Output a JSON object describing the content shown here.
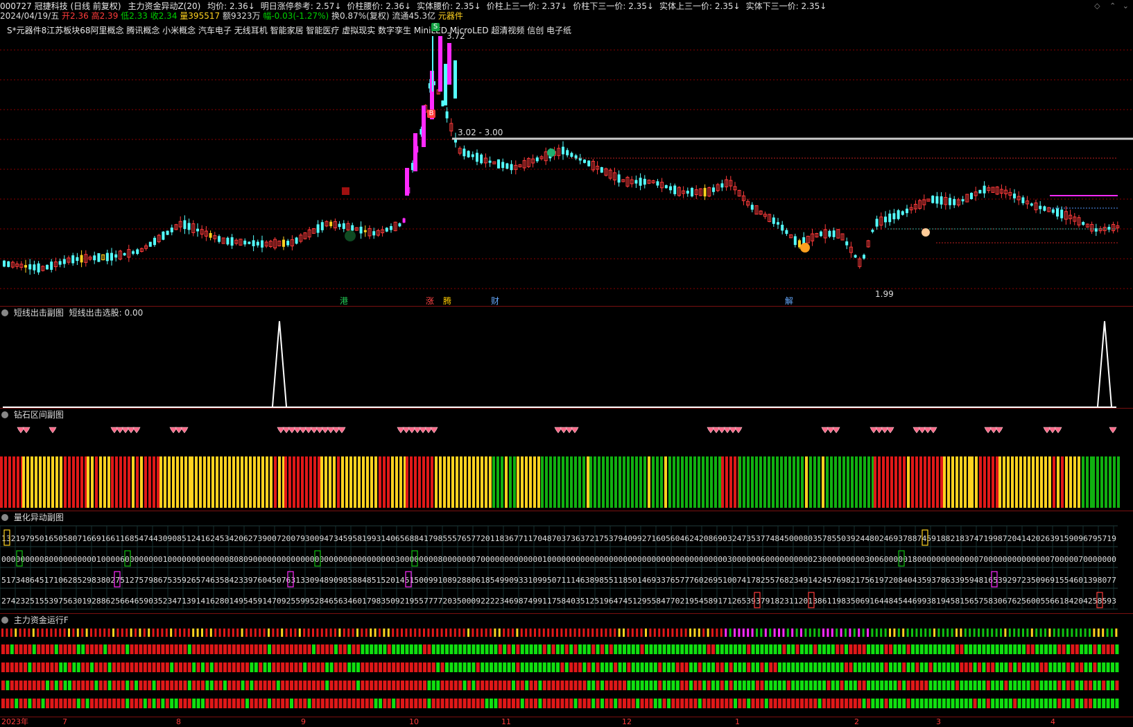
{
  "header": {
    "stock": "000727 冠捷科技 (日线 前复权)",
    "indicator": "主力资金异动Z(20)",
    "items": [
      {
        "label": "均价: 2.36↓",
        "color": "#e0e0e0"
      },
      {
        "label": "明日涨停参考: 2.57↓",
        "color": "#e0e0e0"
      },
      {
        "label": "价柱腰价: 2.36↓",
        "color": "#e0e0e0"
      },
      {
        "label": "实体腰价: 2.35↓",
        "color": "#e0e0e0"
      },
      {
        "label": "价柱上三一价: 2.37↓",
        "color": "#e0e0e0"
      },
      {
        "label": "价柱下三一价: 2.35↓",
        "color": "#e0e0e0"
      },
      {
        "label": "实体上三一价: 2.35↓",
        "color": "#e0e0e0"
      },
      {
        "label": "实体下三一价: 2.35↓",
        "color": "#e0e0e0"
      }
    ]
  },
  "quote": {
    "date": "2024/04/19/五",
    "open": "开2.36",
    "high": "高2.39",
    "low": "低2.33",
    "close": "收2.34",
    "volume": "量395517",
    "amount": "额9323万",
    "change": "幅-0.03(-1.27%)",
    "turnover": "换0.87%(复权)",
    "float": "流通45.3亿",
    "sector": "元器件"
  },
  "concepts": "S*元器件8江苏板块68阿里概念 腾讯概念 小米概念 汽车电子 无线耳机 智能家居 智能医疗 虚拟现实 数字孪生 MiniLED MicroLED 超清视频 信创 电子纸",
  "main_chart": {
    "high_label": "3.72",
    "range_label": "3.02 - 3.00",
    "low_label": "1.99",
    "signals": [
      {
        "label": "港",
        "color": "#22cc55"
      },
      {
        "label": "涨",
        "color": "#ff4444"
      },
      {
        "label": "腾",
        "color": "#ffcc00"
      },
      {
        "label": "财",
        "color": "#66aaff"
      },
      {
        "label": "解",
        "color": "#66aaff"
      }
    ],
    "markers": {
      "buy": "B",
      "sell": "S"
    }
  },
  "panels": {
    "p1_title": "短线出击副图",
    "p1_value": "短线出击选股: 0.00",
    "p2_title": "钻石区间副图",
    "p3_title": "量化异动副图",
    "p4_title": "主力资金运行F"
  },
  "xaxis": {
    "labels": [
      "2023年",
      "7",
      "8",
      "9",
      "10",
      "11",
      "12",
      "1",
      "2",
      "3",
      "4"
    ]
  },
  "colors": {
    "up": "#ff3b3b",
    "down": "#54ffff",
    "yellow": "#ffd21f",
    "green": "#00c000",
    "magenta": "#ff2aff",
    "grid": "#8b0000"
  },
  "icons": [
    "collapse-icon",
    "diamond-icon",
    "buy-marker-icon",
    "sell-marker-icon"
  ]
}
